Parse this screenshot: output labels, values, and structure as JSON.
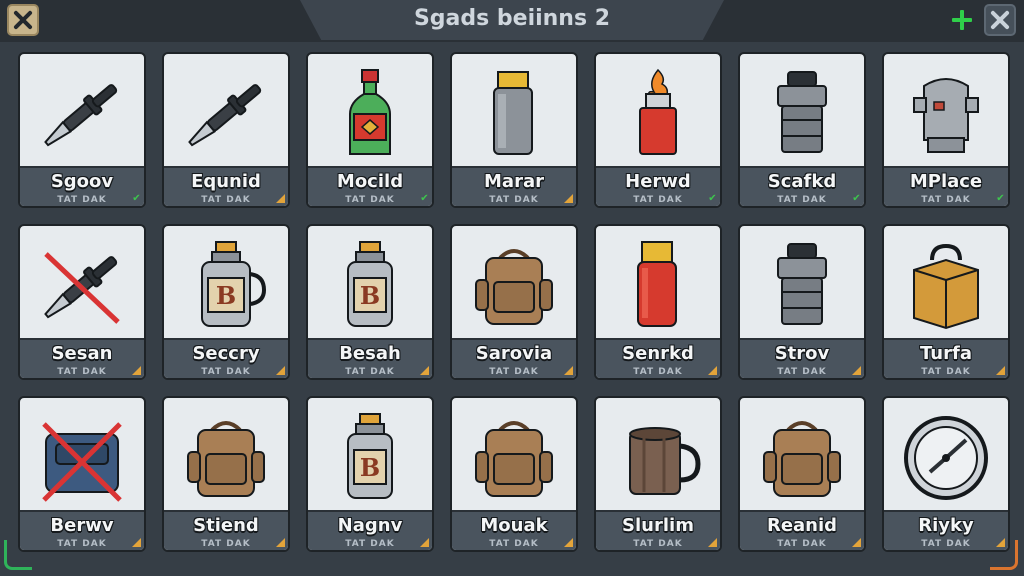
{
  "window": {
    "title": "Sgads beiinns 2"
  },
  "titlebar": {
    "close_left_icon": "close-icon",
    "add_icon": "plus-icon",
    "close_right_icon": "close-icon"
  },
  "colors": {
    "background": "#363e46",
    "card": "#e7ebee",
    "label_band": "#4a545e",
    "check": "#3ec44e",
    "tag": "#e3a43a",
    "plus": "#2fcf4a"
  },
  "items": [
    {
      "label": "Sgoov",
      "sub": "TAT DAK",
      "icon": "knife-icon",
      "flag": "check"
    },
    {
      "label": "Equnid",
      "sub": "TAT DAK",
      "icon": "knife-icon",
      "flag": "tag"
    },
    {
      "label": "Mocild",
      "sub": "TAT DAK",
      "icon": "bottle-icon",
      "flag": "check"
    },
    {
      "label": "Marar",
      "sub": "TAT DAK",
      "icon": "can-icon",
      "flag": "tag"
    },
    {
      "label": "Herwd",
      "sub": "TAT DAK",
      "icon": "lighter-icon",
      "flag": "check"
    },
    {
      "label": "Scafkd",
      "sub": "TAT DAK",
      "icon": "pot-icon",
      "flag": "check"
    },
    {
      "label": "MPlace",
      "sub": "TAT DAK",
      "icon": "stove-icon",
      "flag": "check"
    },
    {
      "label": "Sesan",
      "sub": "TAT DAK",
      "icon": "knife-crossed-icon",
      "flag": "tag"
    },
    {
      "label": "Seccry",
      "sub": "TAT DAK",
      "icon": "jug-icon",
      "flag": "tag"
    },
    {
      "label": "Besah",
      "sub": "TAT DAK",
      "icon": "flask-icon",
      "flag": "tag"
    },
    {
      "label": "Sarovia",
      "sub": "TAT DAK",
      "icon": "backpack-icon",
      "flag": "tag"
    },
    {
      "label": "Senrkd",
      "sub": "TAT DAK",
      "icon": "canister-icon",
      "flag": "tag"
    },
    {
      "label": "Strov",
      "sub": "TAT DAK",
      "icon": "pot-icon",
      "flag": "tag"
    },
    {
      "label": "Turfa",
      "sub": "TAT DAK",
      "icon": "crate-icon",
      "flag": "tag"
    },
    {
      "label": "Berwv",
      "sub": "TAT DAK",
      "icon": "bag-crossed-icon",
      "flag": "tag"
    },
    {
      "label": "Stiend",
      "sub": "TAT DAK",
      "icon": "backpack-icon",
      "flag": "tag"
    },
    {
      "label": "Nagnv",
      "sub": "TAT DAK",
      "icon": "flask-icon",
      "flag": "tag"
    },
    {
      "label": "Mouak",
      "sub": "TAT DAK",
      "icon": "backpack-icon",
      "flag": "tag"
    },
    {
      "label": "Slurlim",
      "sub": "TAT DAK",
      "icon": "mug-icon",
      "flag": "tag"
    },
    {
      "label": "Reanid",
      "sub": "TAT DAK",
      "icon": "backpack-icon",
      "flag": "tag"
    },
    {
      "label": "Riyky",
      "sub": "TAT DAK",
      "icon": "compass-icon",
      "flag": "tag"
    }
  ]
}
